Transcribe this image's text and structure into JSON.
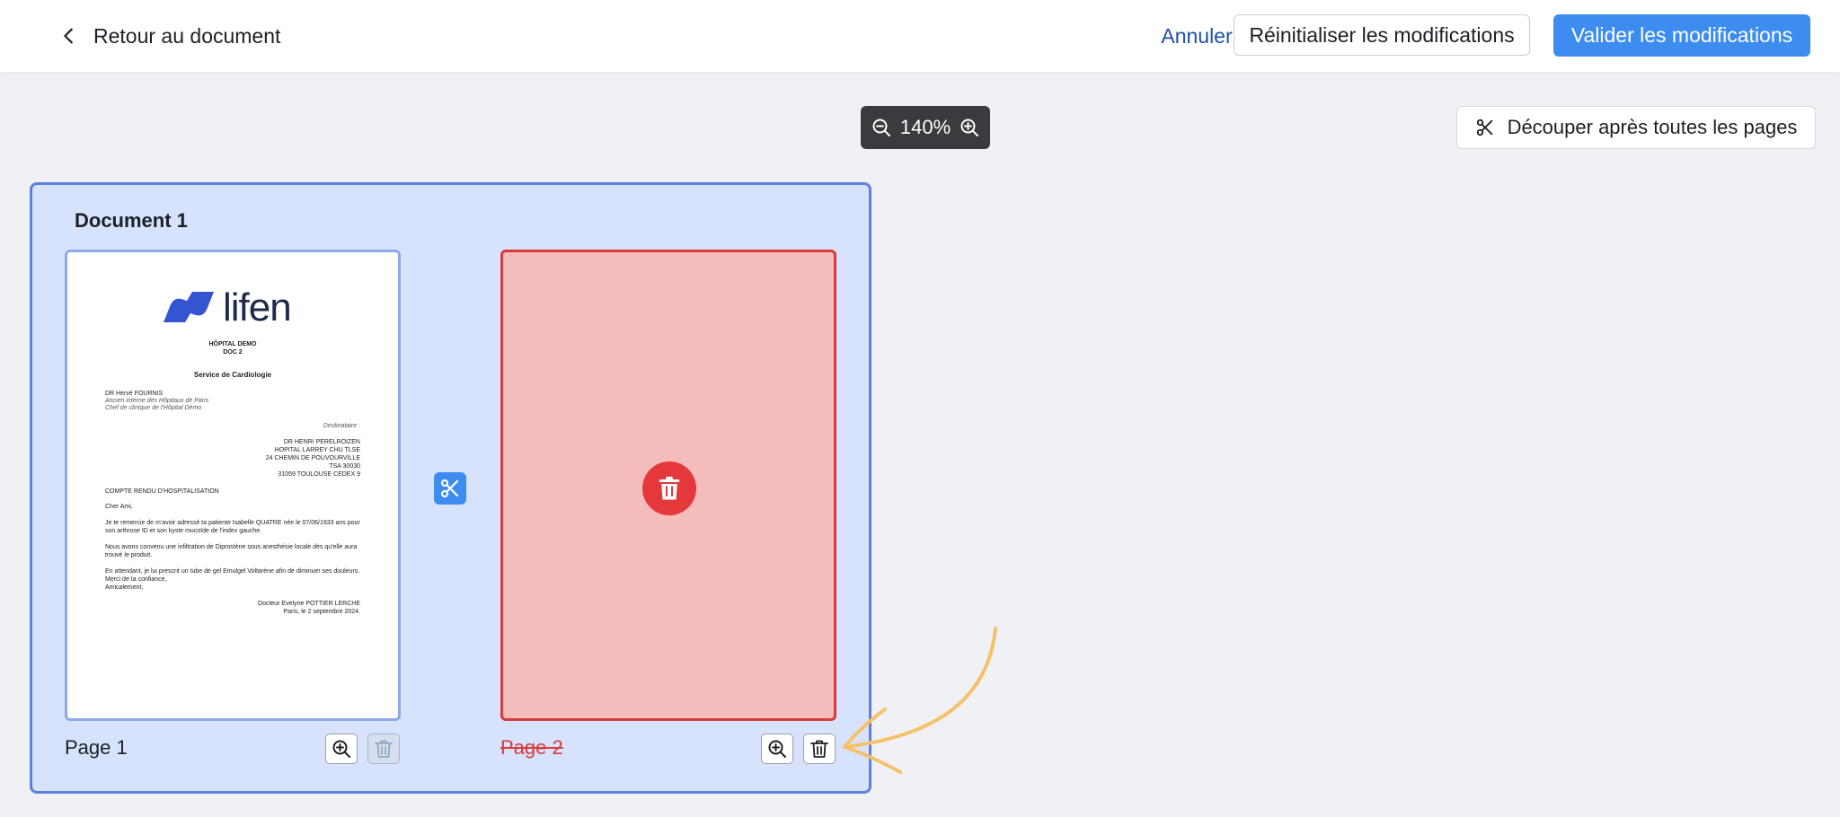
{
  "header": {
    "back_label": "Retour au document",
    "cancel_label": "Annuler",
    "reset_label": "Réinitialiser les modifications",
    "validate_label": "Valider les modifications"
  },
  "toolbar": {
    "zoom_value": "140%",
    "cut_all_label": "Découper après toutes les pages"
  },
  "document": {
    "title": "Document 1",
    "pages": [
      {
        "label": "Page 1",
        "deleted": false
      },
      {
        "label": "Page 2",
        "deleted": true
      }
    ]
  },
  "preview": {
    "logo_text": "lifen",
    "hospital": "HÔPITAL DEMO",
    "doc": "DOC 2",
    "service": "Service de Cardiologie",
    "doctor_name": "DR Hervé FOURNIS",
    "doctor_line1": "Ancien interne des Hôpitaux de Paris",
    "doctor_line2": "Chef de clinique de l'Hôpital Démo",
    "recipient_label": "Destinataire :",
    "recipient_lines": [
      "DR HENRI PERELROIZEN",
      "HOPITAL LARREY CHU TLSE",
      "24 CHEMIN DE POUVOURVILLE",
      "TSA 30030",
      "31059 TOULOUSE CEDEX 9"
    ],
    "report_title": "COMPTE RENDU D'HOSPITALISATION",
    "greeting": "Cher Ami,",
    "body_lines": [
      "Je te remercie de m'avoir adressé ta patiente Isabelle QUATRE née le 07/06/1933 ans pour",
      "son arthrose ID et son kyste mucoïde de l'index gauche.",
      "Nous avons convenu une infiltration de Diprostène sous anesthésie locale dès qu'elle aura",
      "trouvé le produit.",
      "En attendant, je lui prescrit un tube de gel Emulgel Voltarène afin de diminuer ses douleurs.",
      "Merci de ta confiance,",
      "Amicalement,"
    ],
    "signature": "Docteur Evelyne POTTIER LERCHE",
    "date_line": "Paris, le 2 septembre 2024."
  },
  "colors": {
    "primary": "#3d8cf0",
    "danger": "#e4383a",
    "doc_group_bg": "#d7e3fd",
    "doc_group_border": "#5b82dd",
    "deleted_page_bg": "#f4bcbb",
    "arrow": "#f5c26b"
  },
  "icons": {
    "back": "chevron-left-icon",
    "zoom_out": "zoom-out-icon",
    "zoom_in": "zoom-in-icon",
    "scissors": "scissors-icon",
    "trash": "trash-icon"
  }
}
